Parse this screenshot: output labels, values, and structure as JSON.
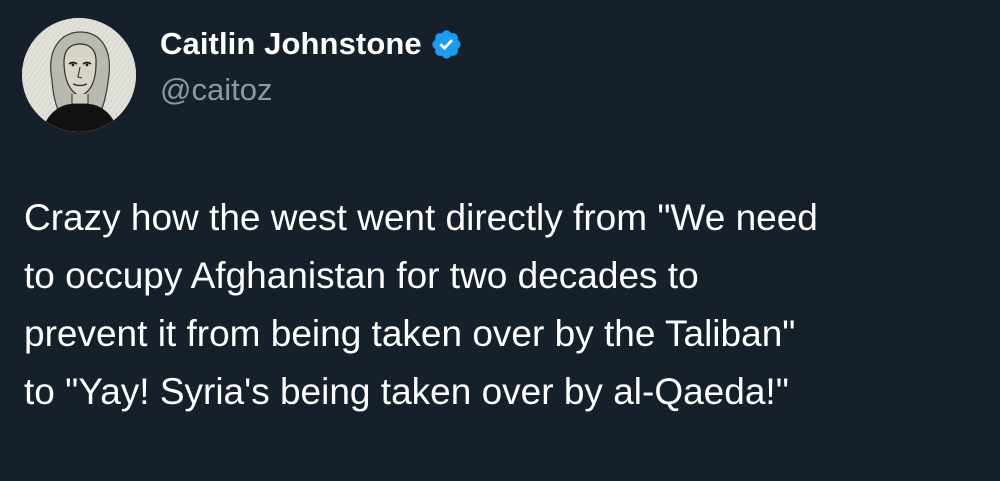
{
  "author": {
    "display_name": "Caitlin Johnstone",
    "handle": "@caitoz",
    "verified_icon": "verified-badge-icon",
    "verified_color": "#1d9bf0"
  },
  "tweet": {
    "lines": [
      "Crazy how the west went directly from \"We need",
      "to occupy Afghanistan for two decades to",
      "prevent it from being taken over by the Taliban\"",
      "to \"Yay! Syria's being taken over by al-Qaeda!\""
    ]
  },
  "theme": {
    "background": "#15202b",
    "primary_text": "#ffffff",
    "secondary_text": "#8b98a5"
  }
}
